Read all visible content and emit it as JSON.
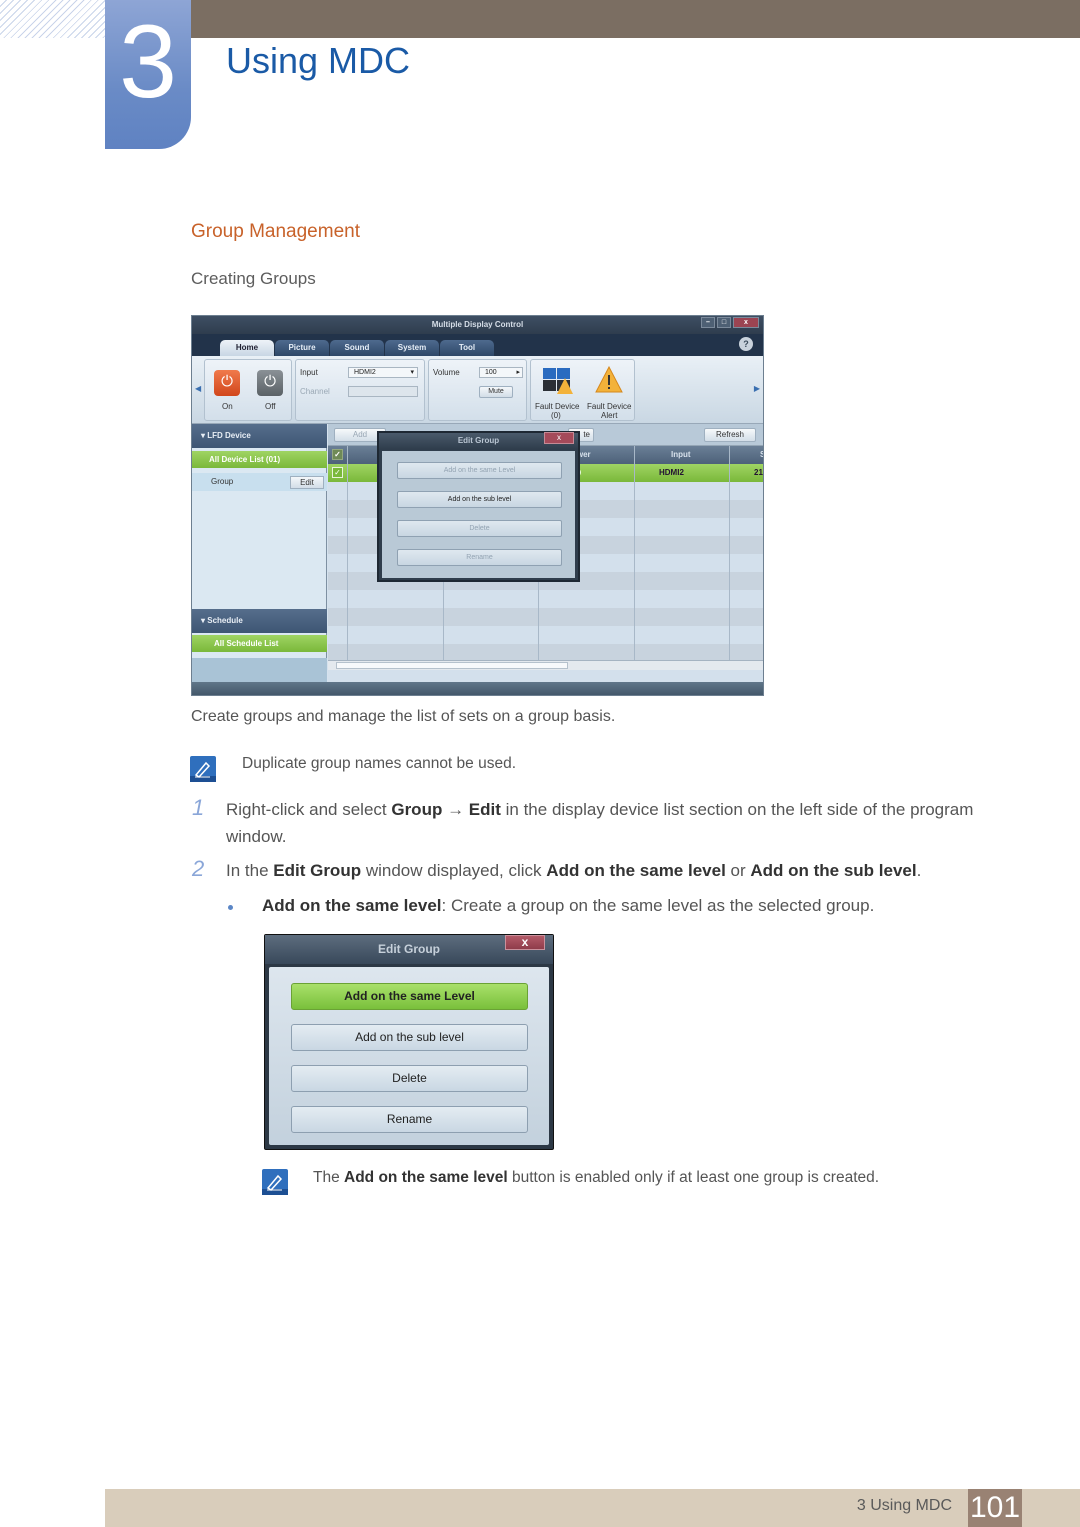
{
  "header": {
    "chapter_number": "3",
    "chapter_title": "Using MDC"
  },
  "section": {
    "title": "Group Management",
    "subtitle": "Creating Groups"
  },
  "mdc_window": {
    "title": "Multiple Display Control",
    "window_controls": {
      "minimize": "–",
      "maximize": "□",
      "close": "x"
    },
    "help": "?",
    "tabs": [
      {
        "label": "Home",
        "active": true
      },
      {
        "label": "Picture",
        "active": false
      },
      {
        "label": "Sound",
        "active": false
      },
      {
        "label": "System",
        "active": false
      },
      {
        "label": "Tool",
        "active": false
      }
    ],
    "ribbon": {
      "power_on": "On",
      "power_off": "Off",
      "input_label": "Input",
      "input_value": "HDMI2",
      "channel_label": "Channel",
      "volume_label": "Volume",
      "volume_value": "100",
      "mute": "Mute",
      "fault_device": "Fault Device",
      "fault_device_count": "(0)",
      "fault_device_alert": "Fault Device",
      "fault_device_alert_2": "Alert"
    },
    "left_panel": {
      "lfd_header": "LFD Device",
      "all_device_list": "All Device List (01)",
      "group_label": "Group",
      "edit_button": "Edit",
      "schedule_header": "Schedule",
      "all_schedule_list": "All Schedule List"
    },
    "grid": {
      "add_button": "Add",
      "delete_button_partial": "te",
      "refresh_button": "Refresh",
      "columns": [
        "ower",
        "Input",
        "S"
      ],
      "row": {
        "input": "HDMI2",
        "extra": "21"
      }
    },
    "edit_group_dialog": {
      "title": "Edit Group",
      "close": "x",
      "buttons": [
        {
          "label": "Add on the same Level",
          "enabled": false
        },
        {
          "label": "Add on the sub level",
          "enabled": true
        },
        {
          "label": "Delete",
          "enabled": false
        },
        {
          "label": "Rename",
          "enabled": false
        }
      ]
    }
  },
  "body": {
    "intro": "Create groups and manage the list of sets on a group basis.",
    "note1": "Duplicate group names cannot be used.",
    "steps": [
      {
        "number": "1",
        "parts": [
          "Right-click and select ",
          "Group",
          " → ",
          "Edit",
          " in the display device list section on the left side of the program"
        ],
        "line2": "window."
      },
      {
        "number": "2",
        "parts": [
          "In the ",
          "Edit Group",
          " window displayed, click ",
          "Add on the same level",
          " or ",
          "Add on the sub level",
          "."
        ]
      }
    ],
    "bullet": {
      "bold": "Add on the same level",
      "rest": ": Create a group on the same level as the selected group."
    },
    "note2": {
      "pre": "The ",
      "bold": "Add on the same level",
      "post": " button is enabled only if at least one group is created."
    }
  },
  "edit_group_dialog_large": {
    "title": "Edit Group",
    "close": "x",
    "buttons": [
      {
        "label": "Add on the same Level",
        "highlighted": true
      },
      {
        "label": "Add on the sub level",
        "highlighted": false
      },
      {
        "label": "Delete",
        "highlighted": false
      },
      {
        "label": "Rename",
        "highlighted": false
      }
    ]
  },
  "footer": {
    "chapter_label": "3 Using MDC",
    "page_number": "101"
  },
  "colors": {
    "chapter_title": "#1a5aa6",
    "section_title": "#c8622a",
    "top_bar": "#7b6e62",
    "footer_bar": "#d9cdbb",
    "page_badge": "#998273",
    "green_highlight": "#7ab83a"
  }
}
